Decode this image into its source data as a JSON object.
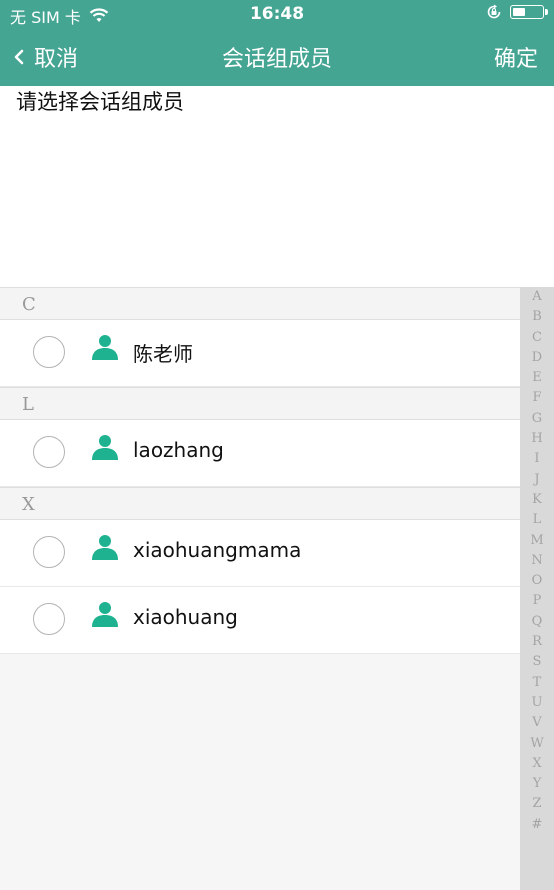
{
  "status_bar": {
    "carrier": "无 SIM 卡",
    "time": "16:48"
  },
  "nav": {
    "cancel_label": "取消",
    "title": "会话组成员",
    "confirm_label": "确定"
  },
  "selected": {
    "placeholder": "请选择会话组成员"
  },
  "sections": [
    {
      "letter": "C",
      "members": [
        {
          "name": "陈老师",
          "selected": false
        }
      ]
    },
    {
      "letter": "L",
      "members": [
        {
          "name": "laozhang",
          "selected": false
        }
      ]
    },
    {
      "letter": "X",
      "members": [
        {
          "name": "xiaohuangmama",
          "selected": false
        },
        {
          "name": "xiaohuang",
          "selected": false
        }
      ]
    }
  ],
  "index_letters": [
    "A",
    "B",
    "C",
    "D",
    "E",
    "F",
    "G",
    "H",
    "I",
    "J",
    "K",
    "L",
    "M",
    "N",
    "O",
    "P",
    "Q",
    "R",
    "S",
    "T",
    "U",
    "V",
    "W",
    "X",
    "Y",
    "Z",
    "#"
  ],
  "colors": {
    "accent": "#45a593",
    "person_icon": "#1fb290"
  },
  "icons": {
    "back": "chevron-left-icon",
    "wifi": "wifi-icon",
    "rotation_lock": "rotation-lock-icon",
    "battery": "battery-icon",
    "member": "person-icon"
  }
}
